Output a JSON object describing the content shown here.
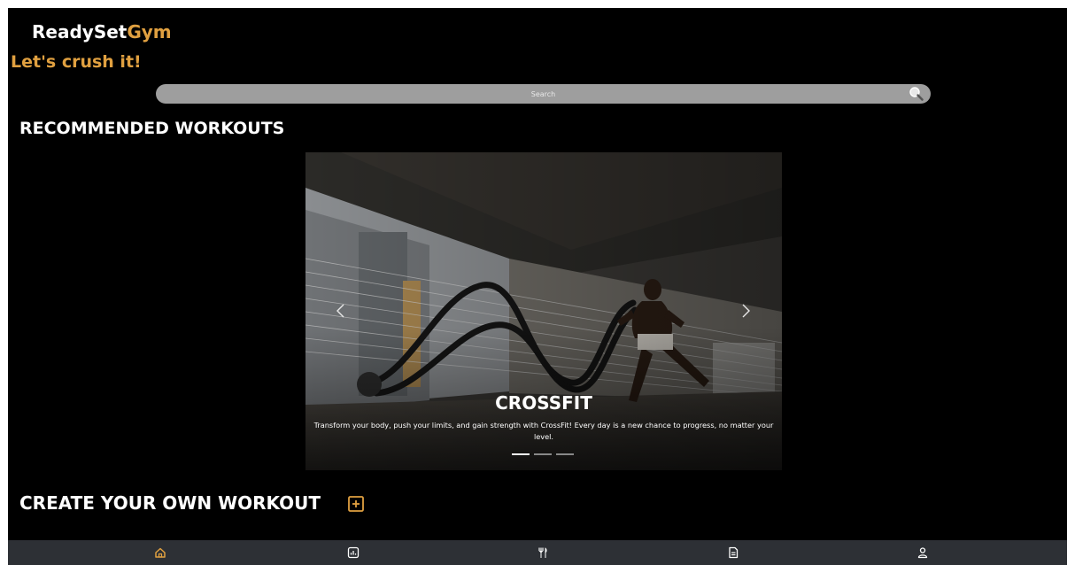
{
  "app": {
    "brand_part1": "ReadySet",
    "brand_part2": "Gym",
    "tagline": "Let's crush it!"
  },
  "search": {
    "placeholder": "Search",
    "icon": "search-icon"
  },
  "sections": {
    "recommended_title": "RECOMMENDED WORKOUTS",
    "create_title": "CREATE YOUR OWN WORKOUT",
    "create_icon": "add-square-icon"
  },
  "carousel": {
    "active_index": 0,
    "slides": [
      {
        "title": "CROSSFIT",
        "description": "Transform your body, push your limits, and gain strength with CrossFit! Every day is a new chance to progress, no matter your level."
      },
      {
        "title": "",
        "description": ""
      },
      {
        "title": "",
        "description": ""
      }
    ],
    "prev_icon": "chevron-left-icon",
    "next_icon": "chevron-right-icon"
  },
  "nav": {
    "active": "home",
    "items": [
      {
        "id": "home",
        "icon": "home-icon"
      },
      {
        "id": "stats",
        "icon": "chart-icon"
      },
      {
        "id": "nutrition",
        "icon": "fork-knife-icon"
      },
      {
        "id": "plans",
        "icon": "document-icon"
      },
      {
        "id": "profile",
        "icon": "user-icon"
      }
    ]
  },
  "colors": {
    "background": "#000000",
    "accent": "#e0a040",
    "search_bg": "#9e9e9e",
    "nav_bg": "#2d3035",
    "text": "#ffffff"
  }
}
